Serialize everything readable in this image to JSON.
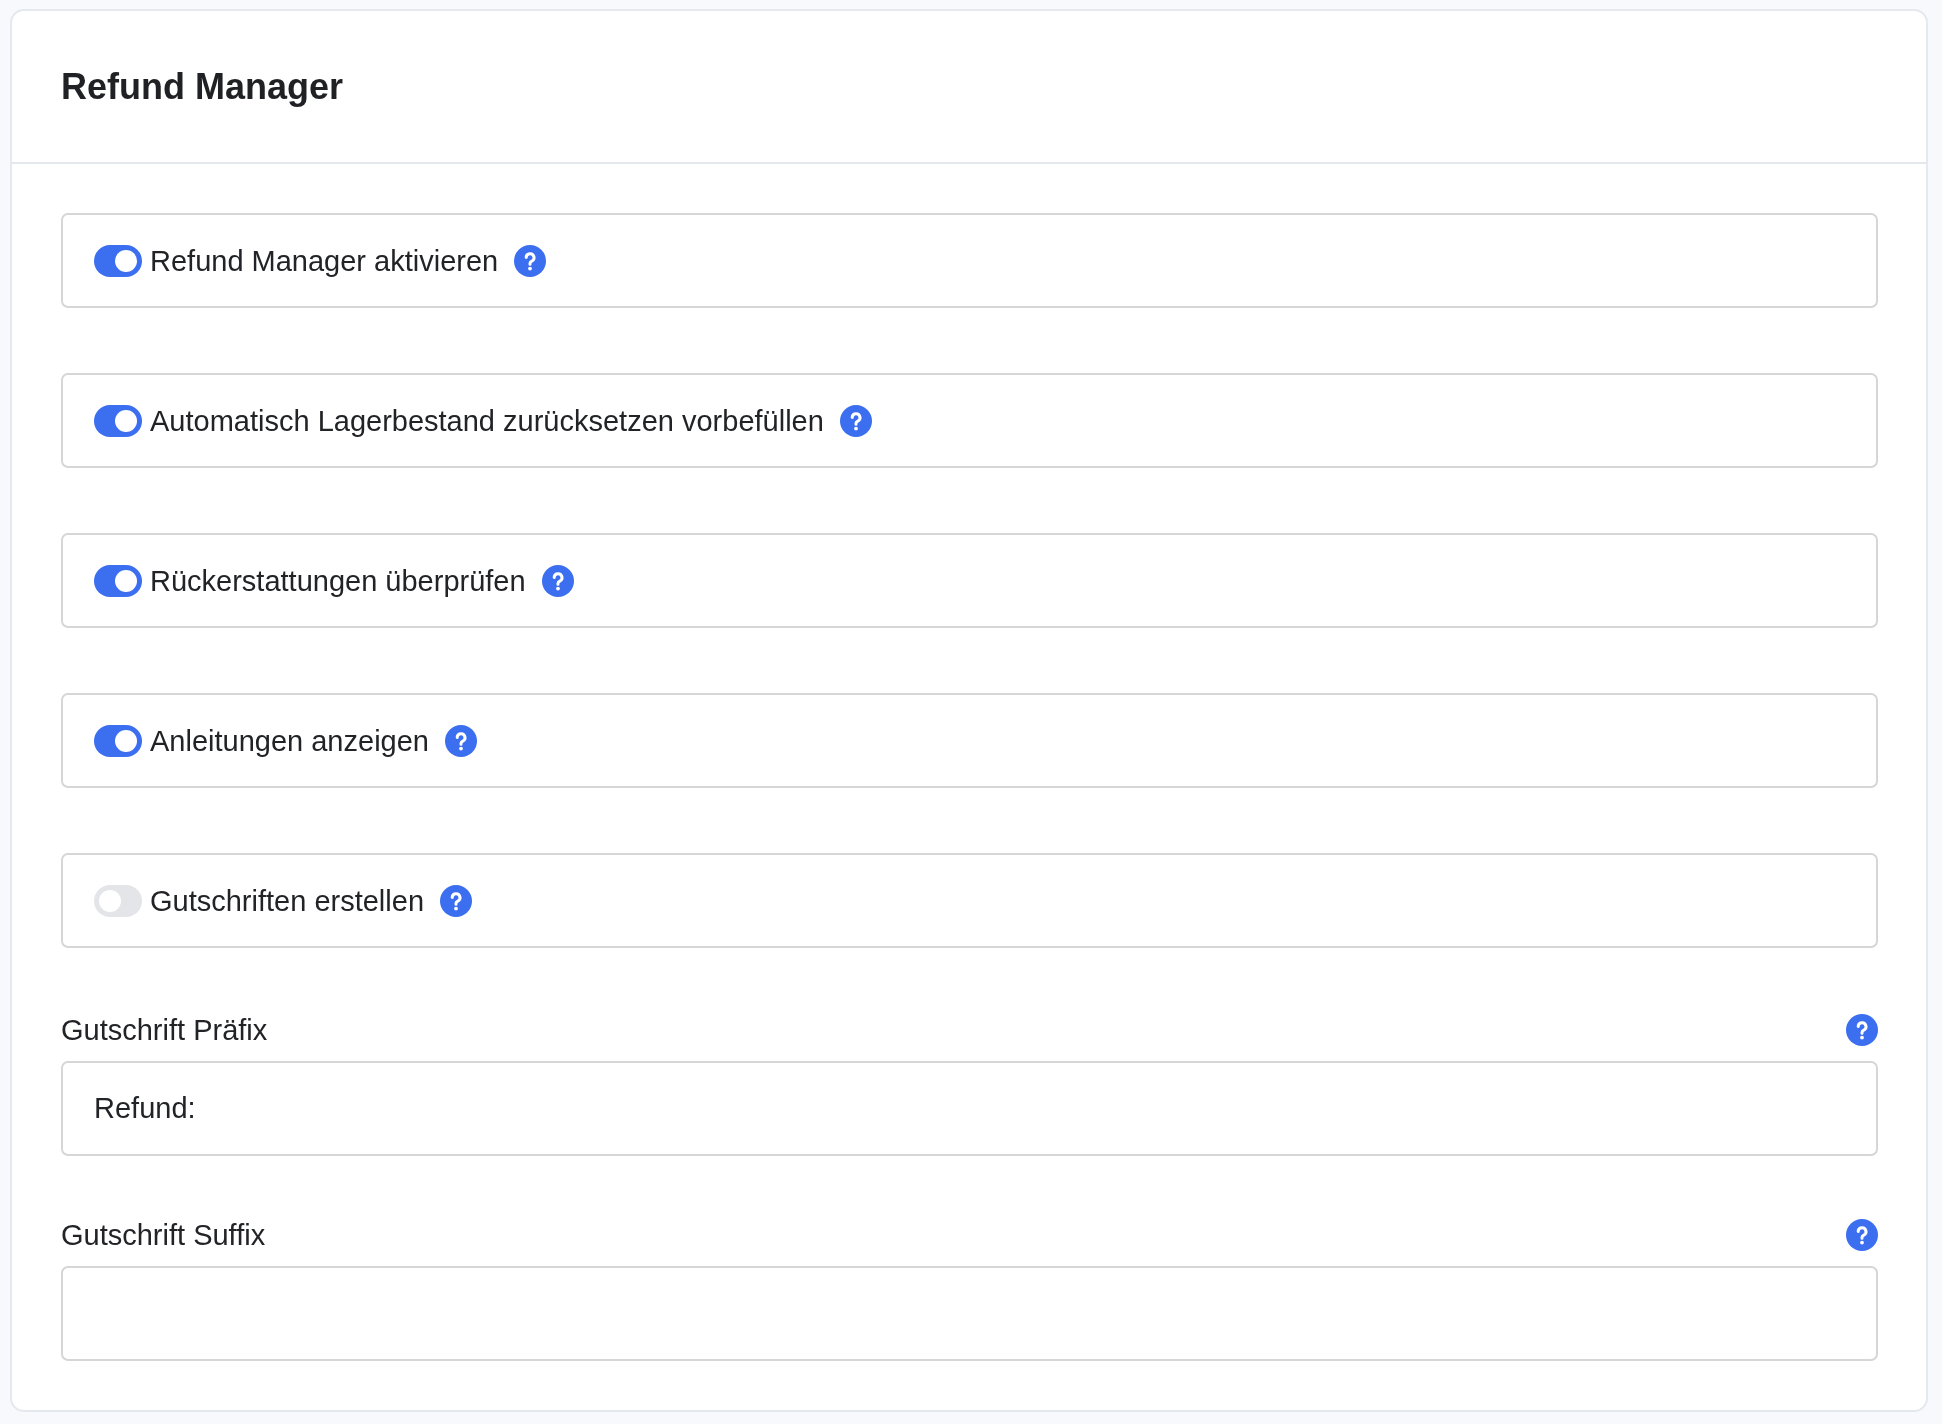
{
  "panel": {
    "title": "Refund Manager"
  },
  "toggles": [
    {
      "label": "Refund Manager aktivieren",
      "on": true
    },
    {
      "label": "Automatisch Lagerbestand zurücksetzen vorbefüllen",
      "on": true
    },
    {
      "label": "Rückerstattungen überprüfen",
      "on": true
    },
    {
      "label": "Anleitungen anzeigen",
      "on": true
    },
    {
      "label": "Gutschriften erstellen",
      "on": false
    }
  ],
  "fields": [
    {
      "label": "Gutschrift Präfix",
      "value": "Refund:"
    },
    {
      "label": "Gutschrift Suffix"
    }
  ]
}
